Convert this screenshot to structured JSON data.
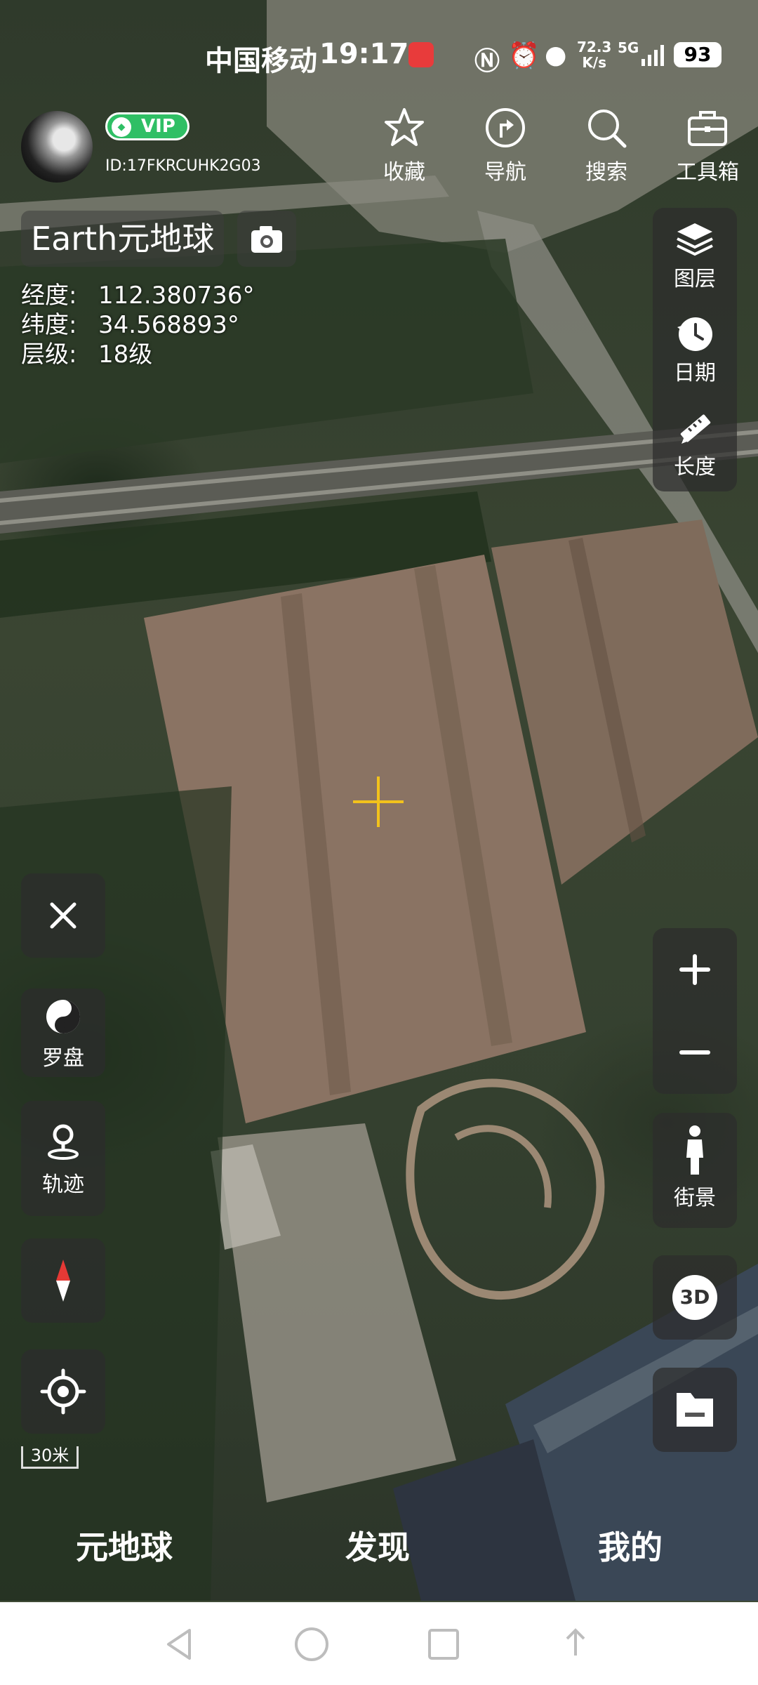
{
  "status_bar": {
    "carrier": "中国移动",
    "time": "19:17",
    "speed_value": "72.3",
    "speed_unit": "K/s",
    "network": "5G",
    "battery": "93"
  },
  "header": {
    "vip_label": "VIP",
    "user_id": "ID:17FKRCUHK2G03",
    "actions": [
      {
        "label": "收藏",
        "icon": "star-icon"
      },
      {
        "label": "导航",
        "icon": "navigation-icon"
      },
      {
        "label": "搜索",
        "icon": "search-icon"
      },
      {
        "label": "工具箱",
        "icon": "toolbox-icon"
      }
    ]
  },
  "map_title": "Earth元地球",
  "coords": {
    "lon_label": "经度:",
    "lon_value": "112.380736°",
    "lat_label": "纬度:",
    "lat_value": "34.568893°",
    "level_label": "层级:",
    "level_value": "18级"
  },
  "right_panel": {
    "layers": "图层",
    "date": "日期",
    "length": "长度",
    "street_view": "街景",
    "three_d": "3D"
  },
  "left_panel": {
    "compass_label": "罗盘",
    "track_label": "轨迹",
    "scale": "30米"
  },
  "tabs": {
    "earth": "元地球",
    "discover": "发现",
    "mine": "我的"
  },
  "colors": {
    "vip_green": "#2fbf65",
    "crosshair": "#f2c21c",
    "compass_red": "#e53935"
  }
}
